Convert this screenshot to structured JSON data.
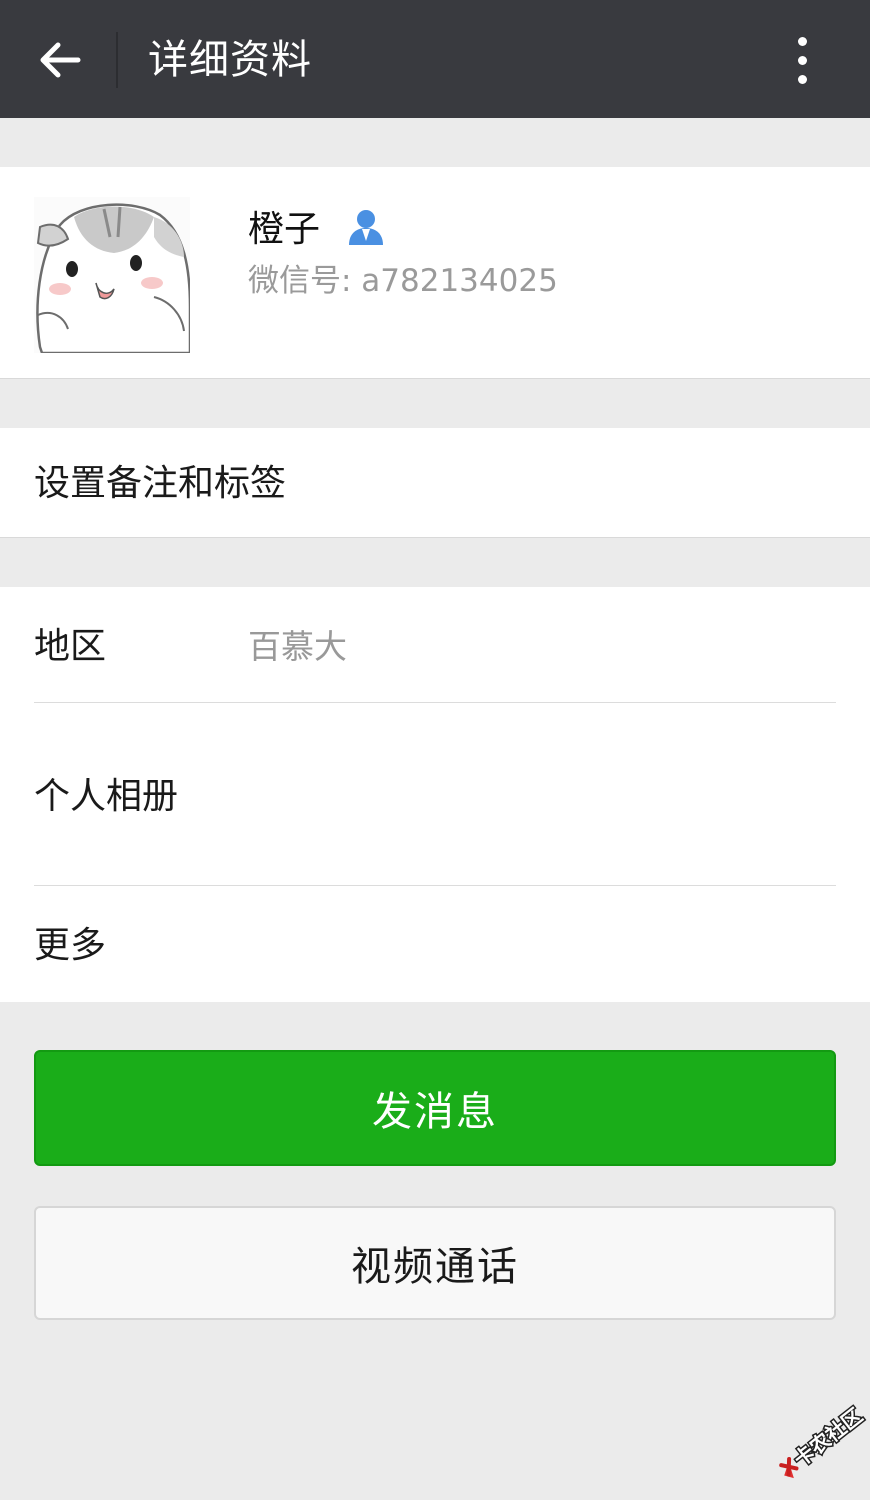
{
  "header": {
    "title": "详细资料",
    "back_icon": "arrow-left-icon",
    "more_icon": "more-vertical-icon",
    "background": "#393a3f"
  },
  "profile": {
    "name": "橙子",
    "wechat_id": "微信号: a782134025",
    "avatar": "hamster-avatar",
    "contact_icon": "person-icon",
    "contact_icon_color": "#4a90e2"
  },
  "remark": {
    "label": "设置备注和标签"
  },
  "info": {
    "region_label": "地区",
    "region_value": "百慕大",
    "album_label": "个人相册",
    "more_label": "更多"
  },
  "actions": {
    "send_label": "发消息",
    "send_color": "#1aad19",
    "video_label": "视频通话"
  },
  "watermark": {
    "text": "卡农社区"
  }
}
